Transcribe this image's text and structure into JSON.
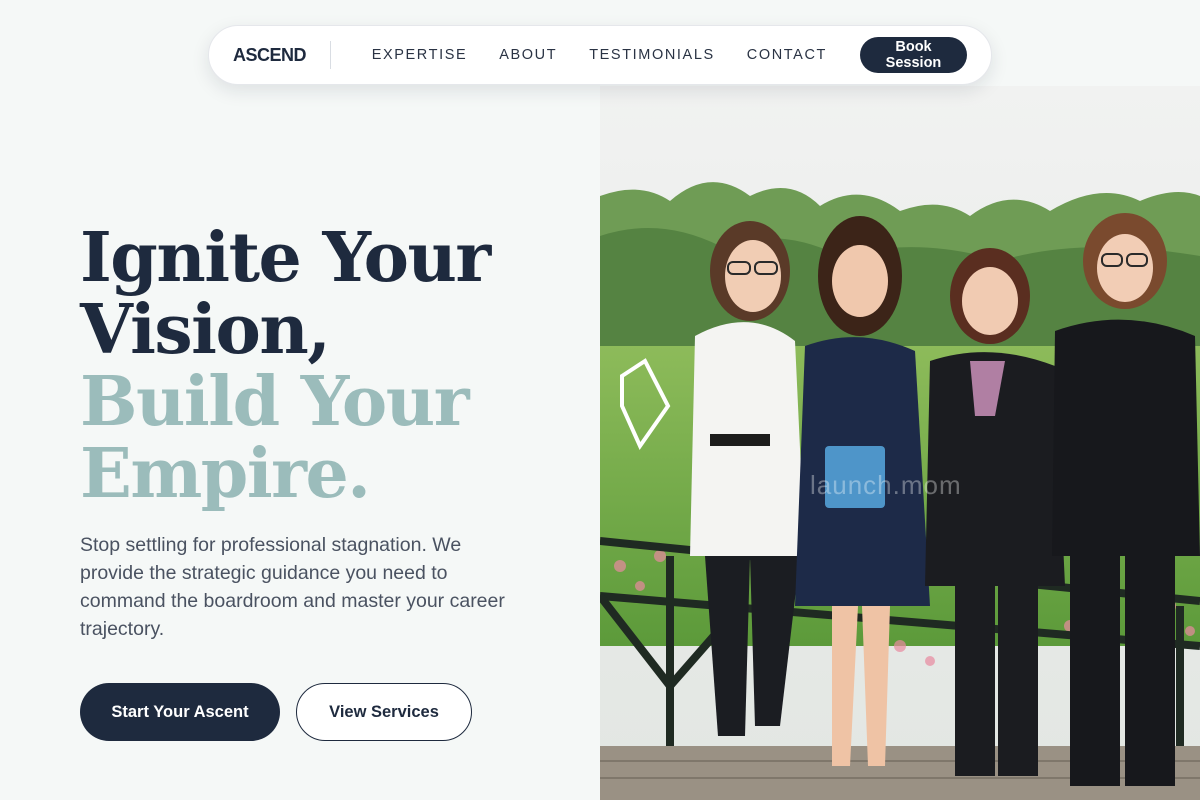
{
  "nav": {
    "brand": "ASCEND",
    "links": [
      "EXPERTISE",
      "ABOUT",
      "TESTIMONIALS",
      "CONTACT"
    ],
    "cta": "Book Session"
  },
  "hero": {
    "headline_dark": [
      "Ignite Your",
      "Vision,"
    ],
    "headline_accent": [
      "Build Your",
      "Empire."
    ],
    "lede": "Stop settling for professional stagnation. We provide the strategic guidance you need to command the boardroom and master your career trajectory.",
    "primary_cta": "Start Your Ascent",
    "secondary_cta": "View Services"
  },
  "photo": {
    "watermark": "launch.mom"
  },
  "colors": {
    "navy": "#1e2a3e",
    "accent_teal": "#9bbcbb",
    "background": "#f5f8f7",
    "body_text": "#4a5261"
  }
}
